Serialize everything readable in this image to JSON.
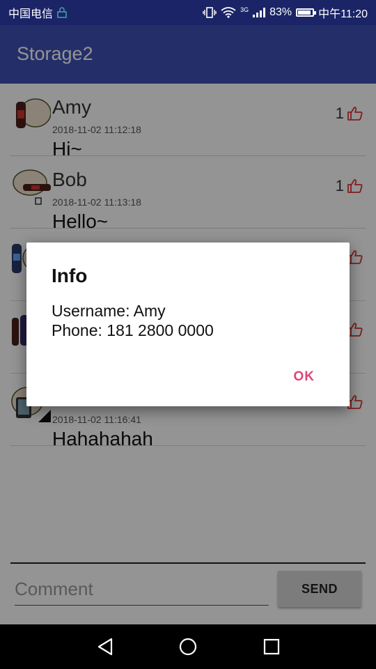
{
  "status_bar": {
    "carrier": "中国电信",
    "battery_percent": "83%",
    "battery_level": 0.83,
    "time": "中午11:20",
    "network_badge": "3G",
    "icons": [
      "lock-icon",
      "vibrate-icon",
      "wifi-icon",
      "signal-icon",
      "battery-icon"
    ]
  },
  "app_bar": {
    "title": "Storage2"
  },
  "posts": [
    {
      "username": "Amy",
      "timestamp": "2018-11-02 11:12:18",
      "message": "Hi~",
      "likes": "1",
      "avatar": "cat-with-bottle-avatar"
    },
    {
      "username": "Bob",
      "timestamp": "2018-11-02 11:13:18",
      "message": "Hello~",
      "likes": "1",
      "avatar": "cat-with-bottle-avatar"
    },
    {
      "username": "",
      "timestamp": "",
      "message": "",
      "likes": "",
      "avatar": "cat-with-bottle-avatar"
    },
    {
      "username": "",
      "timestamp": "",
      "message": "",
      "likes": "",
      "avatar": "cat-with-bottle-avatar"
    },
    {
      "username": "",
      "timestamp": "2018-11-02 11:16:41",
      "message": "Hahahahah",
      "likes": "",
      "avatar": "cat-with-phone-avatar"
    }
  ],
  "comment_box": {
    "placeholder": "Comment",
    "value": ""
  },
  "send_button": {
    "label": "SEND"
  },
  "dialog": {
    "title": "Info",
    "lines": [
      "Username: Amy",
      "Phone: 181 2800 0000"
    ],
    "ok_label": "OK"
  },
  "colors": {
    "status_bar": "#1a2466",
    "app_bar": "#3f51b5",
    "accent": "#e0457a",
    "like_icon": "#d33"
  },
  "nav_bar": {
    "icons": [
      "back-icon",
      "home-icon",
      "recents-icon"
    ]
  }
}
